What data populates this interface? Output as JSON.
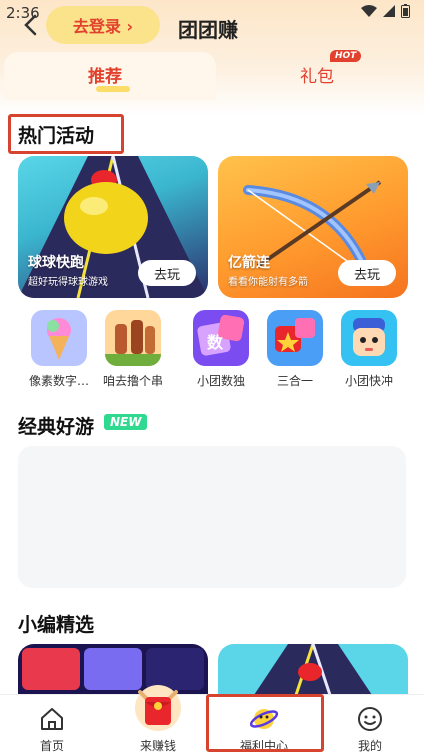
{
  "status": {
    "time": "2:36"
  },
  "header": {
    "login": "去登录 ›",
    "title": "团团赚"
  },
  "tabs": {
    "recommend": "推荐",
    "gift": "礼包",
    "hot": "HOT"
  },
  "hot_section": {
    "title": "热门活动",
    "cards": [
      {
        "name": "球球快跑",
        "subtitle": "超好玩得球球游戏",
        "button": "去玩"
      },
      {
        "name": "亿箭连",
        "subtitle": "看看你能射有多箭",
        "button": "去玩"
      }
    ],
    "mini_games": [
      {
        "label": "像素数字…"
      },
      {
        "label": "咱去撸个串"
      },
      {
        "label": "小团数独"
      },
      {
        "label": "三合一"
      },
      {
        "label": "小团快冲"
      }
    ]
  },
  "classic_section": {
    "title": "经典好游",
    "badge": "NEW"
  },
  "picks_section": {
    "title": "小编精选"
  },
  "bottom_nav": [
    {
      "label": "首页",
      "icon": "home-icon"
    },
    {
      "label": "来赚钱",
      "icon": "red-envelope-icon"
    },
    {
      "label": "福利中心",
      "icon": "planet-icon"
    },
    {
      "label": "我的",
      "icon": "smile-icon"
    }
  ],
  "colors": {
    "accent": "#e2412e",
    "login_pill": "#fbe38b",
    "new_badge": "#2fd98f",
    "highlight_box": "#d6442f"
  }
}
